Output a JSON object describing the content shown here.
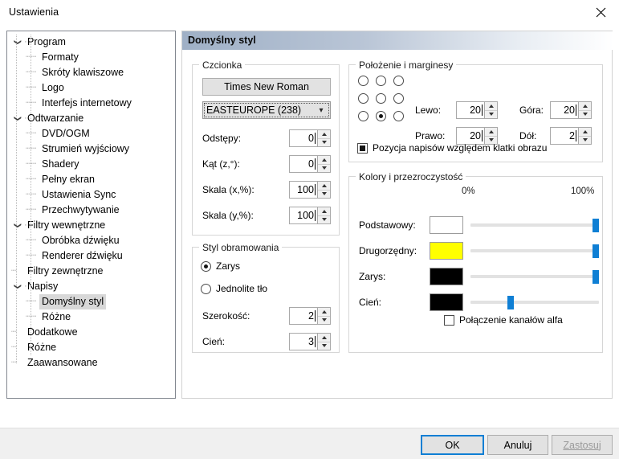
{
  "window": {
    "title": "Ustawienia",
    "close_icon": "close-icon"
  },
  "sidebar": {
    "items": [
      {
        "label": "Program",
        "level": 0,
        "expander": "chevron-down-icon"
      },
      {
        "label": "Formaty",
        "level": 1,
        "expander": ""
      },
      {
        "label": "Skróty klawiszowe",
        "level": 1,
        "expander": ""
      },
      {
        "label": "Logo",
        "level": 1,
        "expander": ""
      },
      {
        "label": "Interfejs internetowy",
        "level": 1,
        "expander": ""
      },
      {
        "label": "Odtwarzanie",
        "level": 0,
        "expander": "chevron-down-icon"
      },
      {
        "label": "DVD/OGM",
        "level": 1,
        "expander": ""
      },
      {
        "label": "Strumień wyjściowy",
        "level": 1,
        "expander": ""
      },
      {
        "label": "Shadery",
        "level": 1,
        "expander": ""
      },
      {
        "label": "Pełny ekran",
        "level": 1,
        "expander": ""
      },
      {
        "label": "Ustawienia Sync",
        "level": 1,
        "expander": ""
      },
      {
        "label": "Przechwytywanie",
        "level": 1,
        "expander": ""
      },
      {
        "label": "Filtry wewnętrzne",
        "level": 0,
        "expander": "chevron-down-icon"
      },
      {
        "label": "Obróbka dźwięku",
        "level": 1,
        "expander": ""
      },
      {
        "label": "Renderer dźwięku",
        "level": 1,
        "expander": ""
      },
      {
        "label": "Filtry zewnętrzne",
        "level": 0,
        "expander": ""
      },
      {
        "label": "Napisy",
        "level": 0,
        "expander": "chevron-down-icon"
      },
      {
        "label": "Domyślny styl",
        "level": 1,
        "expander": "",
        "selected": true
      },
      {
        "label": "Różne",
        "level": 1,
        "expander": ""
      },
      {
        "label": "Dodatkowe",
        "level": 0,
        "expander": ""
      },
      {
        "label": "Różne",
        "level": 0,
        "expander": ""
      },
      {
        "label": "Zaawansowane",
        "level": 0,
        "expander": ""
      }
    ]
  },
  "pane": {
    "header": "Domyślny styl"
  },
  "font_group": {
    "title": "Czcionka",
    "font_button": "Times New Roman",
    "charset_value": "EASTEUROPE (238)",
    "charset_arrow": "chevron-down-icon",
    "fields": [
      {
        "label": "Odstępy:",
        "value": "0"
      },
      {
        "label": "Kąt (z,°):",
        "value": "0"
      },
      {
        "label": "Skala (x,%):",
        "value": "100"
      },
      {
        "label": "Skala (y,%):",
        "value": "100"
      }
    ]
  },
  "border_group": {
    "title": "Styl obramowania",
    "radios": [
      {
        "label": "Zarys",
        "checked": true
      },
      {
        "label": "Jednolite tło",
        "checked": false
      }
    ],
    "fields": [
      {
        "label": "Szerokość:",
        "value": "2"
      },
      {
        "label": "Cień:",
        "value": "3"
      }
    ]
  },
  "position_group": {
    "title": "Położenie i marginesy",
    "alignment_selected_index": 7,
    "alignment_cells": 9,
    "margins": [
      {
        "label": "Lewo:",
        "value": "20"
      },
      {
        "label": "Góra:",
        "value": "20"
      },
      {
        "label": "Prawo:",
        "value": "20"
      },
      {
        "label": "Dół:",
        "value": "2"
      }
    ],
    "checkbox": {
      "label": "Pozycja napisów względem klatki obrazu",
      "state": "indeterminate"
    }
  },
  "colors_group": {
    "title": "Kolory i przezroczystość",
    "scale_min": "0%",
    "scale_max": "100%",
    "rows": [
      {
        "label": "Podstawowy:",
        "color": "#ffffff",
        "alpha_percent": 100
      },
      {
        "label": "Drugorzędny:",
        "color": "#ffff00",
        "alpha_percent": 100
      },
      {
        "label": "Zarys:",
        "color": "#000000",
        "alpha_percent": 100
      },
      {
        "label": "Cień:",
        "color": "#000000",
        "alpha_percent": 30
      }
    ],
    "checkbox": {
      "label": "Połączenie kanałów alfa",
      "state": "unchecked"
    }
  },
  "footer": {
    "ok": "OK",
    "cancel": "Anuluj",
    "apply": "Zastosuj",
    "apply_disabled": true
  },
  "theme": {
    "accent": "#0f7fd4",
    "selection_bg": "#d8d8d8",
    "panel_border": "#828790",
    "footer_bg": "#f0f0f0"
  }
}
